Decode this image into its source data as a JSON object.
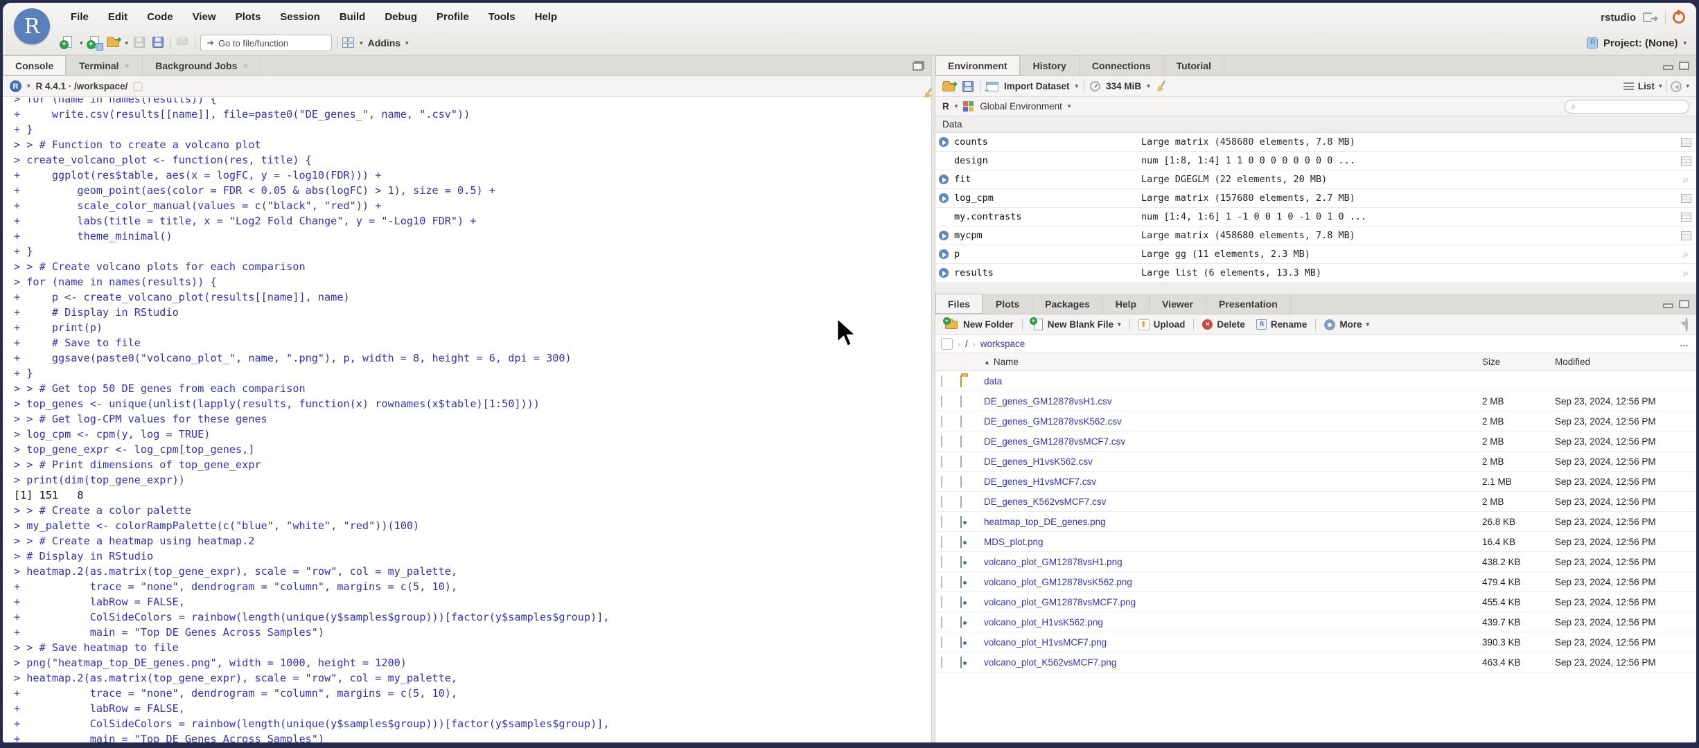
{
  "icons": {
    "caret": "▾",
    "close": "×",
    "ellipsis": "…",
    "sort_asc": "▲",
    "search": "⌕",
    "goto_arrow": "➜",
    "magnifier": "⌕"
  },
  "window": {
    "session_label": "rstudio",
    "project_label": "Project: (None)"
  },
  "menu": {
    "items": [
      "File",
      "Edit",
      "Code",
      "View",
      "Plots",
      "Session",
      "Build",
      "Debug",
      "Profile",
      "Tools",
      "Help"
    ]
  },
  "toolbar": {
    "goto_placeholder": "Go to file/function",
    "addins_label": "Addins"
  },
  "console": {
    "tabs": [
      {
        "label": "Console",
        "active": true,
        "closable": false
      },
      {
        "label": "Terminal",
        "active": false,
        "closable": true
      },
      {
        "label": "Background Jobs",
        "active": false,
        "closable": true
      }
    ],
    "r_version": "R 4.4.1 · /workspace/",
    "lines": [
      {
        "t": "> for (name in names(results)) {",
        "type": "in"
      },
      {
        "t": "+     write.csv(results[[name]], file=paste0(\"DE_genes_\", name, \".csv\"))",
        "type": "in"
      },
      {
        "t": "+ }",
        "type": "in"
      },
      {
        "t": "> > # Function to create a volcano plot",
        "type": "in"
      },
      {
        "t": "> create_volcano_plot <- function(res, title) {",
        "type": "in"
      },
      {
        "t": "+     ggplot(res$table, aes(x = logFC, y = -log10(FDR))) +",
        "type": "in"
      },
      {
        "t": "+         geom_point(aes(color = FDR < 0.05 & abs(logFC) > 1), size = 0.5) +",
        "type": "in"
      },
      {
        "t": "+         scale_color_manual(values = c(\"black\", \"red\")) +",
        "type": "in"
      },
      {
        "t": "+         labs(title = title, x = \"Log2 Fold Change\", y = \"-Log10 FDR\") +",
        "type": "in"
      },
      {
        "t": "+         theme_minimal()",
        "type": "in"
      },
      {
        "t": "+ }",
        "type": "in"
      },
      {
        "t": "> > # Create volcano plots for each comparison",
        "type": "in"
      },
      {
        "t": "> for (name in names(results)) {",
        "type": "in"
      },
      {
        "t": "+     p <- create_volcano_plot(results[[name]], name)",
        "type": "in"
      },
      {
        "t": "+     # Display in RStudio",
        "type": "in"
      },
      {
        "t": "+     print(p)",
        "type": "in"
      },
      {
        "t": "+     # Save to file",
        "type": "in"
      },
      {
        "t": "+     ggsave(paste0(\"volcano_plot_\", name, \".png\"), p, width = 8, height = 6, dpi = 300)",
        "type": "in"
      },
      {
        "t": "+ }",
        "type": "in"
      },
      {
        "t": "> > # Get top 50 DE genes from each comparison",
        "type": "in"
      },
      {
        "t": "> top_genes <- unique(unlist(lapply(results, function(x) rownames(x$table)[1:50])))",
        "type": "in"
      },
      {
        "t": "> > # Get log-CPM values for these genes",
        "type": "in"
      },
      {
        "t": "> log_cpm <- cpm(y, log = TRUE)",
        "type": "in"
      },
      {
        "t": "> top_gene_expr <- log_cpm[top_genes,]",
        "type": "in"
      },
      {
        "t": "> > # Print dimensions of top_gene_expr",
        "type": "in"
      },
      {
        "t": "> print(dim(top_gene_expr))",
        "type": "in"
      },
      {
        "t": "[1] 151   8",
        "type": "out"
      },
      {
        "t": "> > # Create a color palette",
        "type": "in"
      },
      {
        "t": "> my_palette <- colorRampPalette(c(\"blue\", \"white\", \"red\"))(100)",
        "type": "in"
      },
      {
        "t": "> > # Create a heatmap using heatmap.2",
        "type": "in"
      },
      {
        "t": "> # Display in RStudio",
        "type": "in"
      },
      {
        "t": "> heatmap.2(as.matrix(top_gene_expr), scale = \"row\", col = my_palette,",
        "type": "in"
      },
      {
        "t": "+           trace = \"none\", dendrogram = \"column\", margins = c(5, 10),",
        "type": "in"
      },
      {
        "t": "+           labRow = FALSE,",
        "type": "in"
      },
      {
        "t": "+           ColSideColors = rainbow(length(unique(y$samples$group)))[factor(y$samples$group)],",
        "type": "in"
      },
      {
        "t": "+           main = \"Top DE Genes Across Samples\")",
        "type": "in"
      },
      {
        "t": "> > # Save heatmap to file",
        "type": "in"
      },
      {
        "t": "> png(\"heatmap_top_DE_genes.png\", width = 1000, height = 1200)",
        "type": "in"
      },
      {
        "t": "> heatmap.2(as.matrix(top_gene_expr), scale = \"row\", col = my_palette,",
        "type": "in"
      },
      {
        "t": "+           trace = \"none\", dendrogram = \"column\", margins = c(5, 10),",
        "type": "in"
      },
      {
        "t": "+           labRow = FALSE,",
        "type": "in"
      },
      {
        "t": "+           ColSideColors = rainbow(length(unique(y$samples$group)))[factor(y$samples$group)],",
        "type": "in"
      },
      {
        "t": "+           main = \"Top DE Genes Across Samples\")",
        "type": "in"
      }
    ]
  },
  "environment": {
    "tabs": [
      {
        "label": "Environment",
        "active": true,
        "closable": false
      },
      {
        "label": "History",
        "active": false,
        "closable": false
      },
      {
        "label": "Connections",
        "active": false,
        "closable": false
      },
      {
        "label": "Tutorial",
        "active": false,
        "closable": false
      }
    ],
    "toolbar": {
      "import_label": "Import Dataset",
      "memory_label": "334 MiB",
      "view_label": "List"
    },
    "scope": {
      "language": "R",
      "env_label": "Global Environment",
      "search_placeholder": ""
    },
    "section_label": "Data",
    "rows": [
      {
        "name": "counts",
        "value": "Large matrix (458680 elements,  7.8 MB)",
        "expandable": "true",
        "action": "table"
      },
      {
        "name": "design",
        "value": "num [1:8, 1:4] 1 1 0 0 0 0 0 0 0 0 ...",
        "expandable": "false",
        "action": "table"
      },
      {
        "name": "fit",
        "value": "Large DGEGLM (22 elements,  20 MB)",
        "expandable": "true",
        "action": "magnifier"
      },
      {
        "name": "log_cpm",
        "value": "Large matrix (157680 elements,  2.7 MB)",
        "expandable": "true",
        "action": "table"
      },
      {
        "name": "my.contrasts",
        "value": "num [1:4, 1:6] 1 -1 0 0 1 0 -1 0 1 0 ...",
        "expandable": "false",
        "action": "table"
      },
      {
        "name": "mycpm",
        "value": "Large matrix (458680 elements,  7.8 MB)",
        "expandable": "true",
        "action": "table"
      },
      {
        "name": "p",
        "value": "Large gg (11 elements,  2.3 MB)",
        "expandable": "true",
        "action": "magnifier"
      },
      {
        "name": "results",
        "value": "Large list (6 elements,  13.3 MB)",
        "expandable": "true",
        "action": "magnifier"
      }
    ]
  },
  "files": {
    "tabs": [
      {
        "label": "Files",
        "active": true,
        "closable": false
      },
      {
        "label": "Plots",
        "active": false,
        "closable": false
      },
      {
        "label": "Packages",
        "active": false,
        "closable": false
      },
      {
        "label": "Help",
        "active": false,
        "closable": false
      },
      {
        "label": "Viewer",
        "active": false,
        "closable": false
      },
      {
        "label": "Presentation",
        "active": false,
        "closable": false
      }
    ],
    "toolbar": {
      "new_folder": "New Folder",
      "new_blank_file": "New Blank File",
      "upload": "Upload",
      "delete": "Delete",
      "rename": "Rename",
      "more": "More"
    },
    "breadcrumb": {
      "root": "/",
      "current": "workspace"
    },
    "columns": {
      "name": "Name",
      "size": "Size",
      "modified": "Modified"
    },
    "rows": [
      {
        "name": "data",
        "type": "folder",
        "size": "",
        "modified": ""
      },
      {
        "name": "DE_genes_GM12878vsH1.csv",
        "type": "csv",
        "size": "2 MB",
        "modified": "Sep 23, 2024, 12:56 PM"
      },
      {
        "name": "DE_genes_GM12878vsK562.csv",
        "type": "csv",
        "size": "2 MB",
        "modified": "Sep 23, 2024, 12:56 PM"
      },
      {
        "name": "DE_genes_GM12878vsMCF7.csv",
        "type": "csv",
        "size": "2 MB",
        "modified": "Sep 23, 2024, 12:56 PM"
      },
      {
        "name": "DE_genes_H1vsK562.csv",
        "type": "csv",
        "size": "2 MB",
        "modified": "Sep 23, 2024, 12:56 PM"
      },
      {
        "name": "DE_genes_H1vsMCF7.csv",
        "type": "csv",
        "size": "2.1 MB",
        "modified": "Sep 23, 2024, 12:56 PM"
      },
      {
        "name": "DE_genes_K562vsMCF7.csv",
        "type": "csv",
        "size": "2 MB",
        "modified": "Sep 23, 2024, 12:56 PM"
      },
      {
        "name": "heatmap_top_DE_genes.png",
        "type": "png",
        "size": "26.8 KB",
        "modified": "Sep 23, 2024, 12:56 PM"
      },
      {
        "name": "MDS_plot.png",
        "type": "png",
        "size": "16.4 KB",
        "modified": "Sep 23, 2024, 12:56 PM"
      },
      {
        "name": "volcano_plot_GM12878vsH1.png",
        "type": "png",
        "size": "438.2 KB",
        "modified": "Sep 23, 2024, 12:56 PM"
      },
      {
        "name": "volcano_plot_GM12878vsK562.png",
        "type": "png",
        "size": "479.4 KB",
        "modified": "Sep 23, 2024, 12:56 PM"
      },
      {
        "name": "volcano_plot_GM12878vsMCF7.png",
        "type": "png",
        "size": "455.4 KB",
        "modified": "Sep 23, 2024, 12:56 PM"
      },
      {
        "name": "volcano_plot_H1vsK562.png",
        "type": "png",
        "size": "439.7 KB",
        "modified": "Sep 23, 2024, 12:56 PM"
      },
      {
        "name": "volcano_plot_H1vsMCF7.png",
        "type": "png",
        "size": "390.3 KB",
        "modified": "Sep 23, 2024, 12:56 PM"
      },
      {
        "name": "volcano_plot_K562vsMCF7.png",
        "type": "png",
        "size": "463.4 KB",
        "modified": "Sep 23, 2024, 12:56 PM"
      }
    ]
  }
}
